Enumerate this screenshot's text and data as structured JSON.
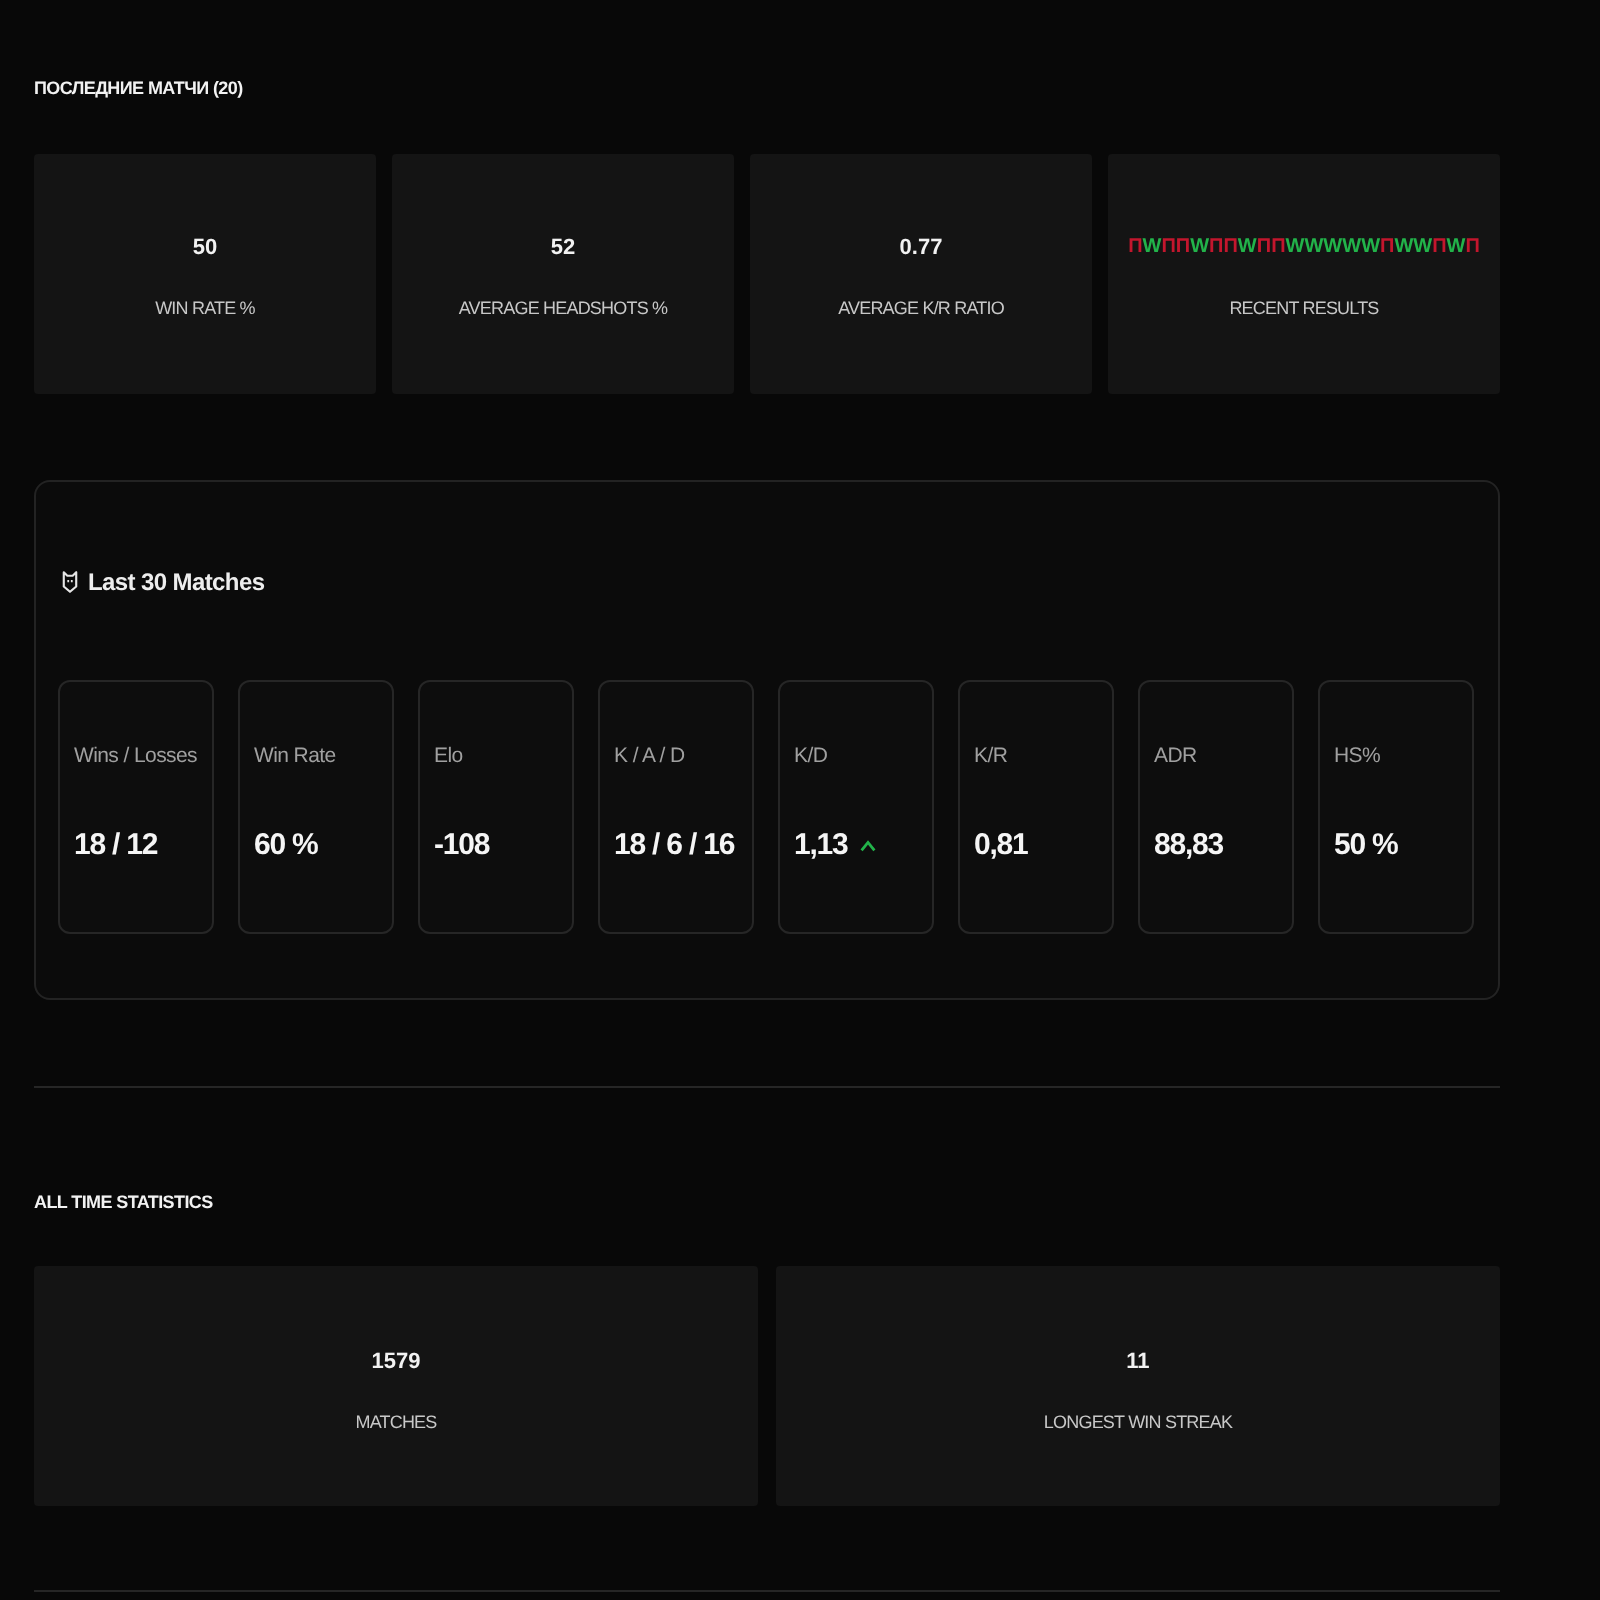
{
  "recent": {
    "title": "ПОСЛЕДНИЕ МАТЧИ (20)",
    "cards": [
      {
        "kind": "stat",
        "value": "50",
        "label": "WIN RATE %"
      },
      {
        "kind": "stat",
        "value": "52",
        "label": "AVERAGE HEADSHOTS %"
      },
      {
        "kind": "stat",
        "value": "0.77",
        "label": "AVERAGE K/R RATIO"
      },
      {
        "kind": "results",
        "results": [
          {
            "text": "П",
            "color": "#c3162d"
          },
          {
            "text": "W",
            "color": "#22b34a"
          },
          {
            "text": "П",
            "color": "#c3162d"
          },
          {
            "text": "П",
            "color": "#c3162d"
          },
          {
            "text": "W",
            "color": "#22b34a"
          },
          {
            "text": "П",
            "color": "#c3162d"
          },
          {
            "text": "П",
            "color": "#c3162d"
          },
          {
            "text": "W",
            "color": "#22b34a"
          },
          {
            "text": "П",
            "color": "#c3162d"
          },
          {
            "text": "П",
            "color": "#c3162d"
          },
          {
            "text": "W",
            "color": "#22b34a"
          },
          {
            "text": "W",
            "color": "#22b34a"
          },
          {
            "text": "W",
            "color": "#22b34a"
          },
          {
            "text": "W",
            "color": "#22b34a"
          },
          {
            "text": "W",
            "color": "#22b34a"
          },
          {
            "text": "П",
            "color": "#c3162d"
          },
          {
            "text": "W",
            "color": "#22b34a"
          },
          {
            "text": "W",
            "color": "#22b34a"
          },
          {
            "text": "П",
            "color": "#c3162d"
          },
          {
            "text": "W",
            "color": "#22b34a"
          },
          {
            "text": "П",
            "color": "#c3162d"
          }
        ],
        "label": "RECENT RESULTS"
      }
    ]
  },
  "last_matches": {
    "title": "Last 30 Matches",
    "stats": [
      {
        "label": "Wins / Losses",
        "value": "18 / 12",
        "trend_up": false
      },
      {
        "label": "Win Rate",
        "value": "60 %",
        "trend_up": false
      },
      {
        "label": "Elo",
        "value": "-108",
        "trend_up": false
      },
      {
        "label": "K / A / D",
        "value": "18 / 6 / 16",
        "trend_up": false
      },
      {
        "label": "K/D",
        "value": "1,13",
        "trend_up": true
      },
      {
        "label": "K/R",
        "value": "0,81",
        "trend_up": false
      },
      {
        "label": "ADR",
        "value": "88,83",
        "trend_up": false
      },
      {
        "label": "HS%",
        "value": "50 %",
        "trend_up": false
      }
    ]
  },
  "all_time": {
    "title": "ALL TIME STATISTICS",
    "cards": [
      {
        "value": "1579",
        "label": "MATCHES"
      },
      {
        "value": "11",
        "label": "LONGEST WIN STREAK"
      }
    ]
  }
}
